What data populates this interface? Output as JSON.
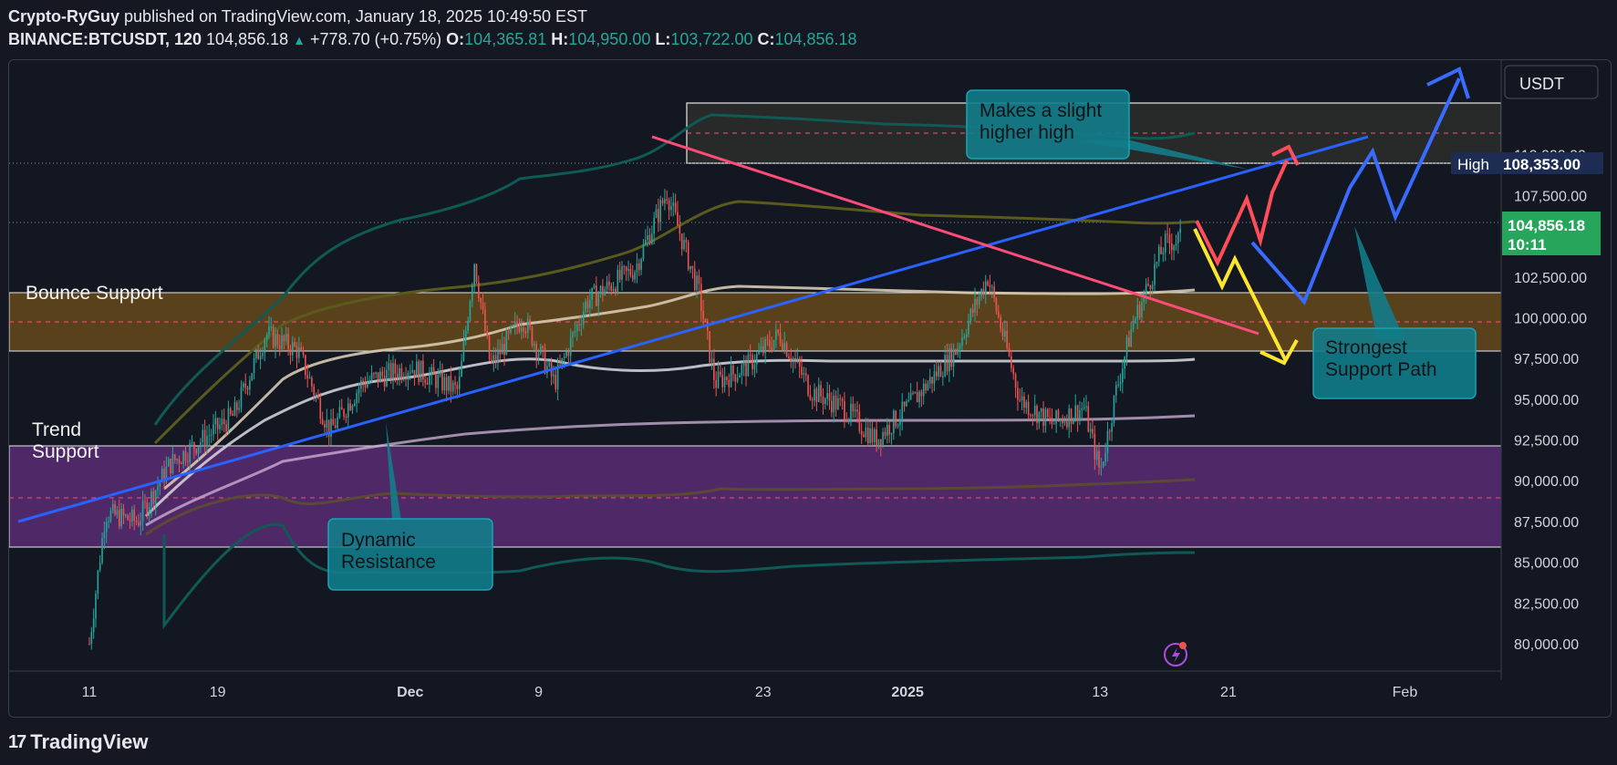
{
  "header": {
    "author": "Crypto-RyGuy",
    "published_text": "published on TradingView.com, January 18, 2025 10:49:50 EST",
    "symbol": "BINANCE:BTCUSDT, 120",
    "last": "104,856.18",
    "change": "+778.70 (+0.75%)",
    "o_label": "O:",
    "o": "104,365.81",
    "h_label": "H:",
    "h": "104,950.00",
    "l_label": "L:",
    "l": "103,722.00",
    "c_label": "C:",
    "c": "104,856.18"
  },
  "currency": "USDT",
  "price_tag": {
    "value": "104,856.18",
    "countdown": "10:11"
  },
  "high_tag": {
    "label": "High",
    "value": "108,353.00"
  },
  "zones": {
    "bounce": {
      "label": "Bounce Support"
    },
    "trend": {
      "label_line1": "Trend",
      "label_line2": "Support"
    }
  },
  "callouts": {
    "higher_high": {
      "line1": "Makes a slight",
      "line2": "higher high"
    },
    "dynamic": {
      "line1": "Dynamic",
      "line2": "Resistance"
    },
    "strongest": {
      "line1": "Strongest",
      "line2": "Support Path"
    }
  },
  "footer": {
    "brand": "TradingView"
  },
  "colors": {
    "background": "#131722",
    "up": "#26a69a",
    "down": "#ef5350",
    "blue_line": "#2962ff",
    "pink_line": "#ff4d7a",
    "bounce_zone": "#6b4e1a",
    "trend_zone": "#5b2d73",
    "callout": "#127c8a",
    "red_arrow": "#ff4d5a",
    "yellow_arrow": "#ffe52e",
    "blue_arrow": "#3a6bff"
  },
  "chart_data": {
    "type": "candlestick",
    "title": "BINANCE:BTCUSDT, 120",
    "y_ticks": [
      "110,000.00",
      "107,500.00",
      "102,500.00",
      "100,000.00",
      "97,500.00",
      "95,000.00",
      "92,500.00",
      "90,000.00",
      "87,500.00",
      "85,000.00",
      "82,500.00",
      "80,000.00"
    ],
    "y_tick_values": [
      110000,
      107500,
      102500,
      100000,
      97500,
      95000,
      92500,
      90000,
      87500,
      85000,
      82500,
      80000
    ],
    "ylim": [
      78600,
      115800
    ],
    "x_ticks": [
      "11",
      "19",
      "Dec",
      "9",
      "23",
      "2025",
      "13",
      "21",
      "Feb"
    ],
    "x_tick_dates": [
      "2024-11-11",
      "2024-11-19",
      "2024-12-01",
      "2024-12-09",
      "2024-12-23",
      "2025-01-01",
      "2025-01-13",
      "2025-01-21",
      "2025-02-01"
    ],
    "xlim": [
      "2024-11-06",
      "2025-02-07"
    ],
    "price_path": [
      [
        "2024-11-11",
        80000
      ],
      [
        "2024-11-12",
        88000
      ],
      [
        "2024-11-14",
        87500
      ],
      [
        "2024-11-16",
        91000
      ],
      [
        "2024-11-20",
        94000
      ],
      [
        "2024-11-22",
        99000
      ],
      [
        "2024-11-24",
        98000
      ],
      [
        "2024-11-26",
        93000
      ],
      [
        "2024-11-28",
        96000
      ],
      [
        "2024-12-01",
        97000
      ],
      [
        "2024-12-04",
        95500
      ],
      [
        "2024-12-05",
        103500
      ],
      [
        "2024-12-06",
        97000
      ],
      [
        "2024-12-08",
        100000
      ],
      [
        "2024-12-10",
        96000
      ],
      [
        "2024-12-12",
        101000
      ],
      [
        "2024-12-15",
        103000
      ],
      [
        "2024-12-17",
        107700
      ],
      [
        "2024-12-19",
        101500
      ],
      [
        "2024-12-20",
        96000
      ],
      [
        "2024-12-22",
        97000
      ],
      [
        "2024-12-24",
        99000
      ],
      [
        "2024-12-26",
        95500
      ],
      [
        "2024-12-28",
        94500
      ],
      [
        "2024-12-30",
        92500
      ],
      [
        "2025-01-01",
        94500
      ],
      [
        "2025-01-04",
        98000
      ],
      [
        "2025-01-06",
        102500
      ],
      [
        "2025-01-08",
        95000
      ],
      [
        "2025-01-10",
        93500
      ],
      [
        "2025-01-12",
        94500
      ],
      [
        "2025-01-13",
        90500
      ],
      [
        "2025-01-14",
        95500
      ],
      [
        "2025-01-15",
        99500
      ],
      [
        "2025-01-17",
        104500
      ],
      [
        "2025-01-18",
        104856
      ]
    ],
    "bounce_zone": [
      97300,
      100700
    ],
    "trend_zone": [
      86000,
      91900
    ],
    "high_box": [
      108353,
      111850
    ],
    "high_level": 108353,
    "last_price": 104856.18
  }
}
